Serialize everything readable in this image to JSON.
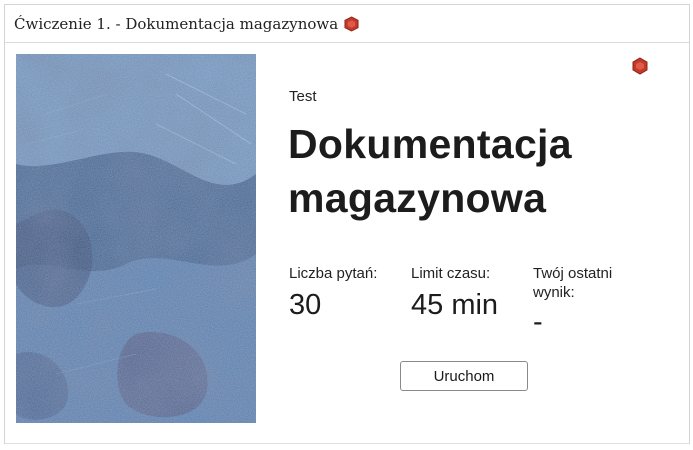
{
  "header": {
    "title": "Ćwiczenie 1. - Dokumentacja magazynowa",
    "icon": "hexagon-icon"
  },
  "colors": {
    "accent_hexagon": "#c0392b",
    "cover_base": "#4a6f9e",
    "border": "#d4d4d4"
  },
  "cover": {
    "icon": "cover-image-blue-texture"
  },
  "quiz": {
    "type_label": "Test",
    "title": "Dokumentacja magazynowa",
    "corner_icon": "hexagon-icon",
    "stats": [
      {
        "label": "Liczba pytań:",
        "value": "30"
      },
      {
        "label": "Limit czasu:",
        "value": "45 min"
      },
      {
        "label": "Twój ostatni wynik:",
        "value": "-"
      }
    ],
    "start_button_label": "Uruchom"
  }
}
